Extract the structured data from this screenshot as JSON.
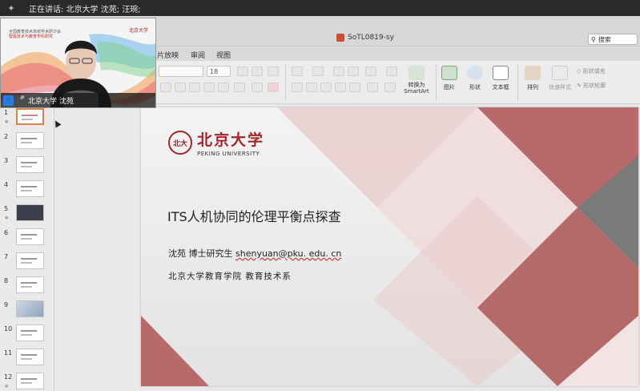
{
  "meeting": {
    "speaking_label": "正在讲话: 北京大学 沈苑; 汪琬;",
    "video_caption": "北京大学 沈苑",
    "video_slide_title_1": "全国教育技术高校学术研讨会",
    "video_slide_title_2": "智能技术与教育学科研究",
    "video_logo_text": "北京大学"
  },
  "window": {
    "doc_title": "SoTL0819-sy",
    "search_placeholder": "搜索"
  },
  "ribbon_tabs": [
    "片放映",
    "审阅",
    "视图"
  ],
  "ribbon": {
    "font_size": "18",
    "convert_smartart": "转换为\nSmartArt",
    "picture": "图片",
    "shape": "形状",
    "textbox": "文本框",
    "arrange": "排列",
    "quick_style": "快速样式",
    "shape_fill": "形状填充",
    "shape_outline": "形状轮廓"
  },
  "thumbnails": [
    {
      "num": "1",
      "star": "★",
      "style": "sel"
    },
    {
      "num": "2",
      "star": "",
      "style": "plain"
    },
    {
      "num": "3",
      "star": "",
      "style": "plain"
    },
    {
      "num": "4",
      "star": "",
      "style": "plain"
    },
    {
      "num": "5",
      "star": "★",
      "style": "dark"
    },
    {
      "num": "6",
      "star": "",
      "style": "plain"
    },
    {
      "num": "7",
      "star": "",
      "style": "plain"
    },
    {
      "num": "8",
      "star": "",
      "style": "plain"
    },
    {
      "num": "9",
      "star": "",
      "style": "pic"
    },
    {
      "num": "10",
      "star": "",
      "style": "plain"
    },
    {
      "num": "11",
      "star": "",
      "style": "plain"
    },
    {
      "num": "12",
      "star": "★",
      "style": "plain"
    }
  ],
  "slide": {
    "logo_cn": "北京大学",
    "logo_en": "PEKING UNIVERSITY",
    "title": "ITS人机协同的伦理平衡点探查",
    "author": "沈苑  博士研究生",
    "email": "shenyuan@pku. edu. cn",
    "department": "北京大学教育学院  教育技术系"
  },
  "colors": {
    "accent": "#a3262a",
    "ribbon_bg": "#ececec"
  }
}
